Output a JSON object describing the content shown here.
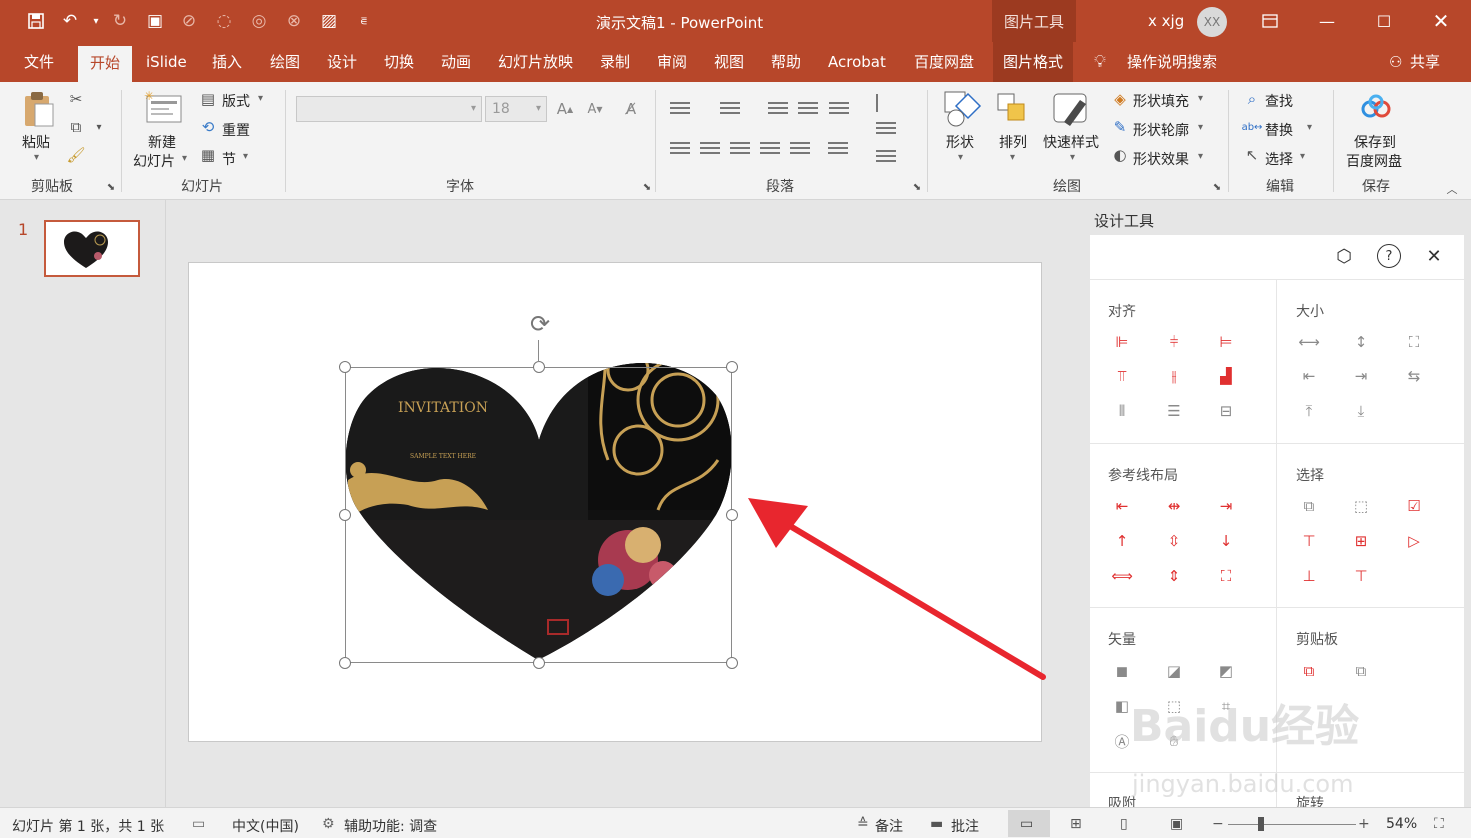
{
  "title_bar": {
    "doc_title": "演示文稿1 - PowerPoint",
    "contextual_tab_group": "图片工具",
    "user_name": "x xjg",
    "avatar_initials": "XX",
    "brand_color": "#b7472a"
  },
  "tabs": [
    {
      "label": "文件"
    },
    {
      "label": "开始"
    },
    {
      "label": "iSlide"
    },
    {
      "label": "插入"
    },
    {
      "label": "绘图"
    },
    {
      "label": "设计"
    },
    {
      "label": "切换"
    },
    {
      "label": "动画"
    },
    {
      "label": "幻灯片放映"
    },
    {
      "label": "录制"
    },
    {
      "label": "审阅"
    },
    {
      "label": "视图"
    },
    {
      "label": "帮助"
    },
    {
      "label": "Acrobat"
    },
    {
      "label": "百度网盘"
    },
    {
      "label": "图片格式"
    }
  ],
  "tell_me": "操作说明搜索",
  "share": "共享",
  "ribbon": {
    "clipboard": {
      "group": "剪贴板",
      "paste": "粘贴"
    },
    "slides": {
      "group": "幻灯片",
      "new_slide_1": "新建",
      "new_slide_2": "幻灯片",
      "layout": "版式",
      "reset": "重置",
      "section": "节"
    },
    "font": {
      "group": "字体",
      "font_size": "18"
    },
    "paragraph": {
      "group": "段落"
    },
    "drawing": {
      "group": "绘图",
      "shapes": "形状",
      "arrange": "排列",
      "quick_styles": "快速样式",
      "shape_fill": "形状填充",
      "shape_outline": "形状轮廓",
      "shape_effects": "形状效果"
    },
    "editing": {
      "group": "编辑",
      "find": "查找",
      "replace": "替换",
      "select": "选择"
    },
    "save": {
      "group": "保存",
      "save_to_1": "保存到",
      "save_to_2": "百度网盘"
    }
  },
  "slide_panel": {
    "slide_number": "1"
  },
  "slide": {
    "invitation_title": "INVITATION",
    "invitation_sub": "SAMPLE TEXT HERE"
  },
  "design_panel": {
    "title": "设计工具",
    "sections": {
      "align": "对齐",
      "size": "大小",
      "guides": "参考线布局",
      "select": "选择",
      "vector": "矢量",
      "clipboard": "剪贴板",
      "bottom_left": "吸附",
      "bottom_right": "旋转"
    }
  },
  "watermark": {
    "text": "Baidu经验",
    "url": "jingyan.baidu.com"
  },
  "status_bar": {
    "slide_info": "幻灯片 第 1 张，共 1 张",
    "language": "中文(中国)",
    "accessibility": "辅助功能: 调查",
    "notes": "备注",
    "comments": "批注",
    "zoom": "54%"
  }
}
